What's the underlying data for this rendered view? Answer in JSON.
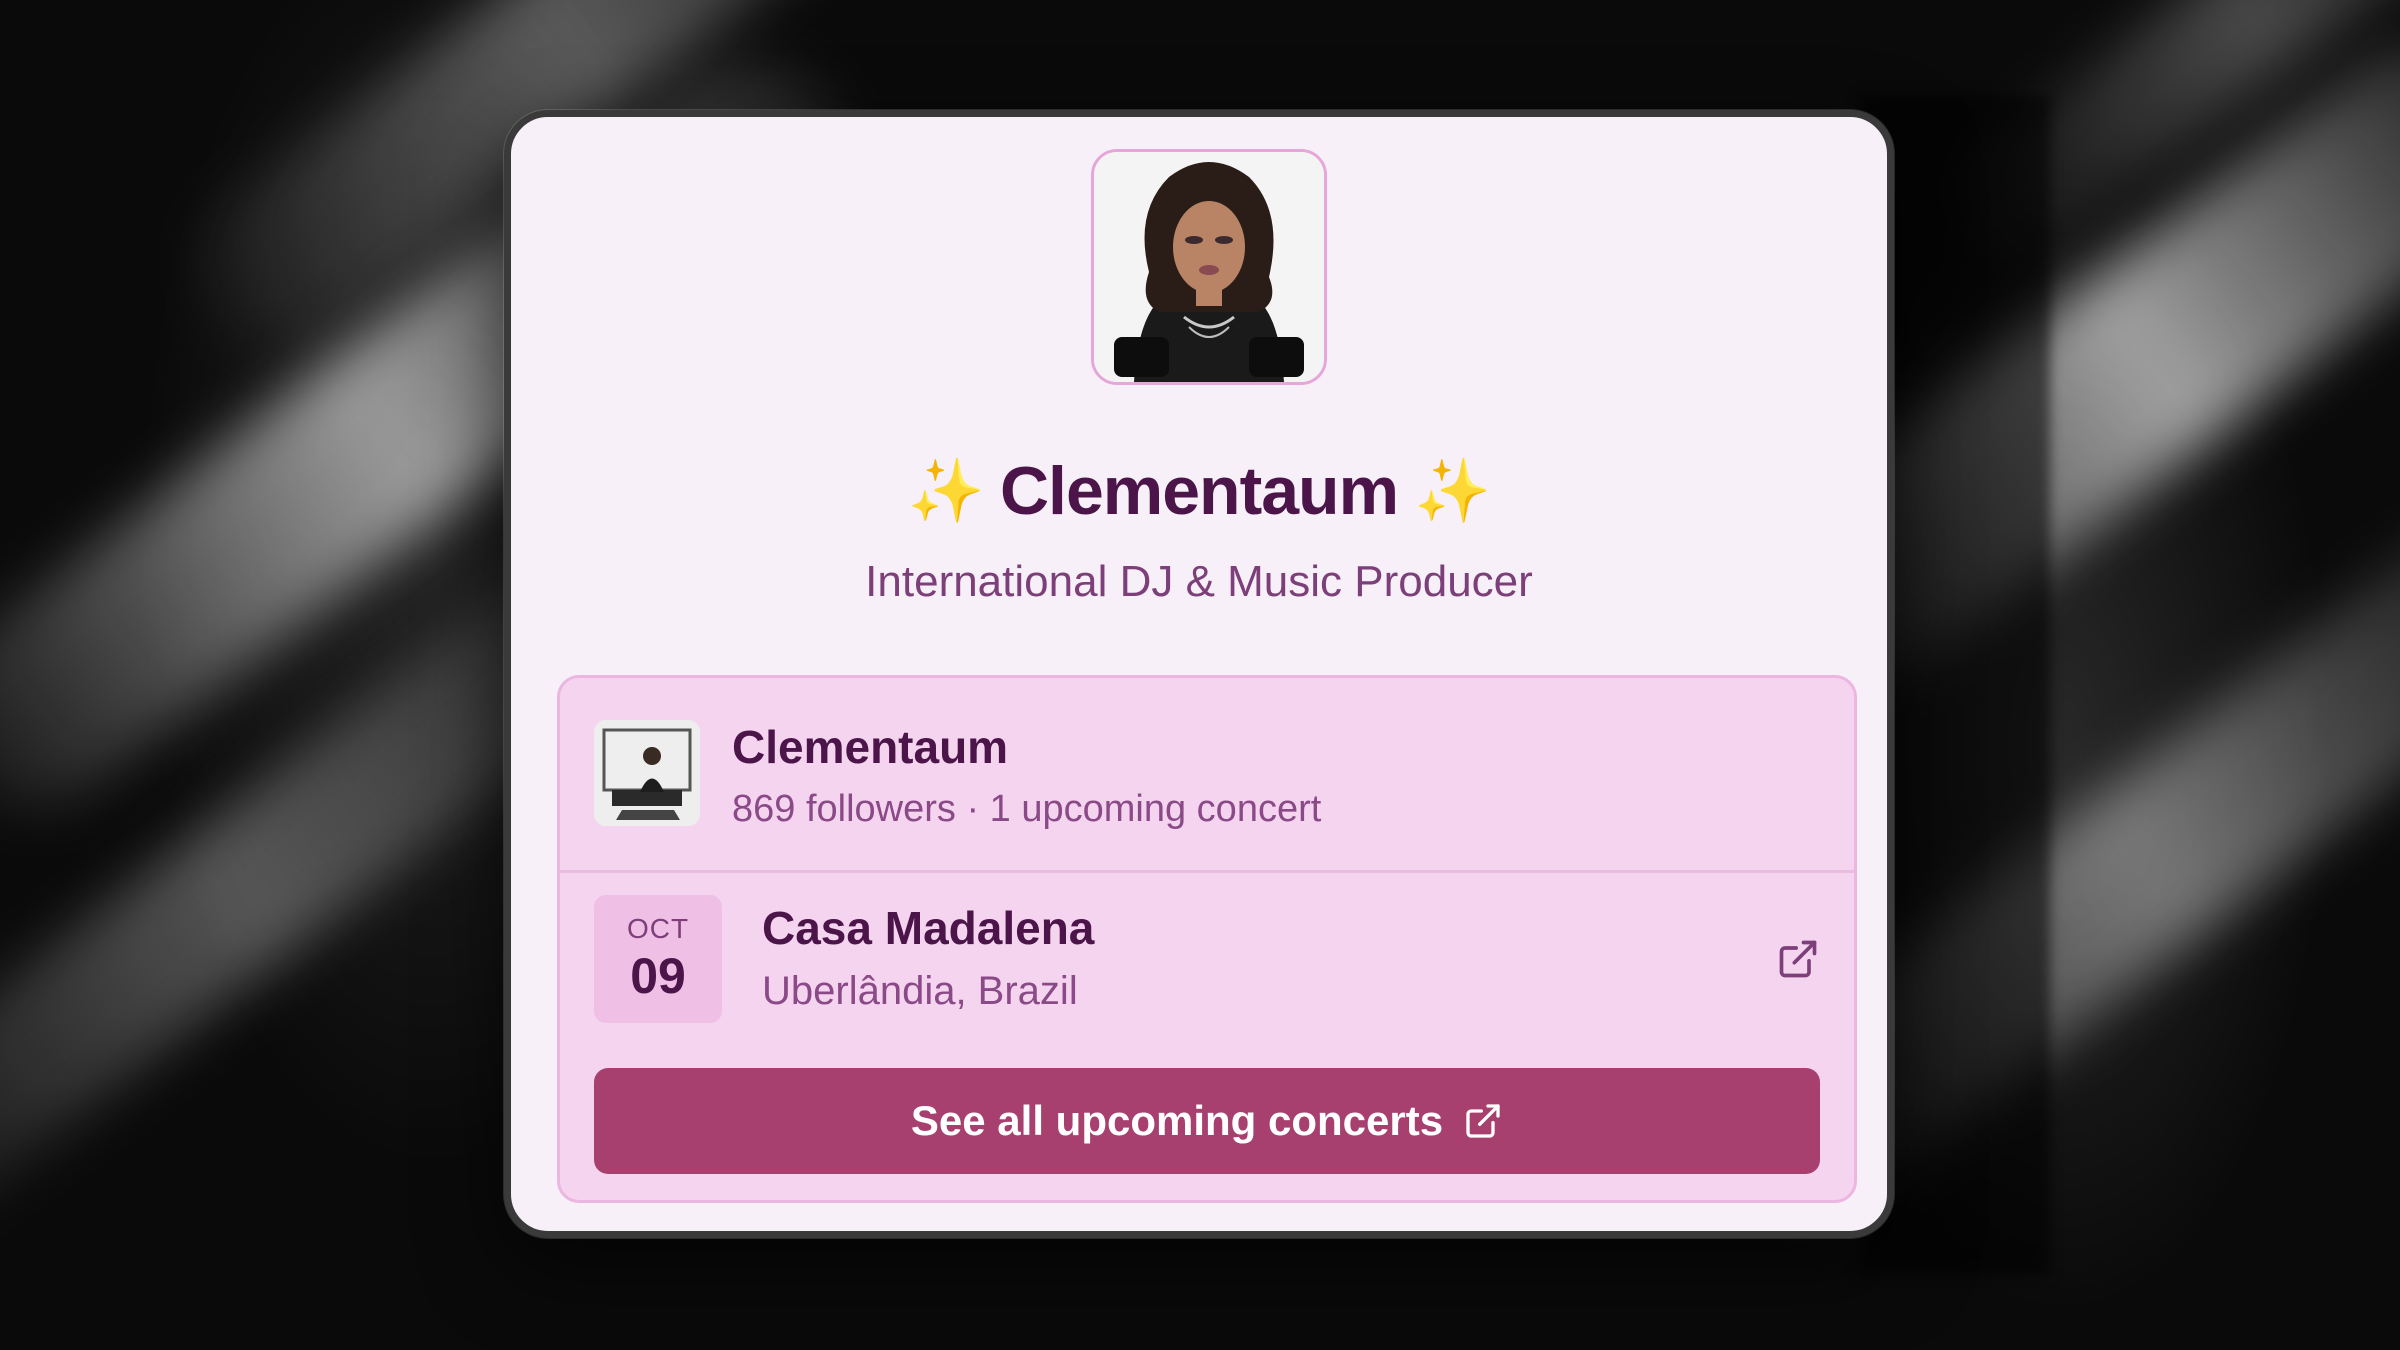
{
  "profile": {
    "sparkle_left": "✨",
    "name": "Clementaum",
    "sparkle_right": "✨",
    "tagline": "International DJ & Music Producer"
  },
  "widget": {
    "artist_name": "Clementaum",
    "artist_meta": "869 followers · 1 upcoming concert",
    "concerts": [
      {
        "month": "OCT",
        "day": "09",
        "venue": "Casa Madalena",
        "location": "Uberlândia, Brazil"
      }
    ],
    "cta_label": "See all upcoming concerts"
  },
  "colors": {
    "accent": "#a8406f",
    "title": "#4b154a",
    "widget_bg": "#f5d4ef",
    "card_bg": "#f8f0f8",
    "sparkle": "#f2c230"
  },
  "icons": {
    "external_link": "external-link-icon",
    "sparkle": "sparkles-icon"
  }
}
